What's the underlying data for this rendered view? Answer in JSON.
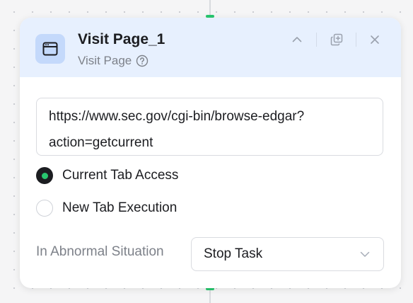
{
  "node": {
    "title": "Visit Page_1",
    "subtitle": "Visit Page",
    "icon": "browser-window-icon"
  },
  "header_actions": [
    {
      "name": "collapse",
      "icon": "chevron-up-icon"
    },
    {
      "name": "duplicate",
      "icon": "copy-icon"
    },
    {
      "name": "close",
      "icon": "close-icon"
    }
  ],
  "url": {
    "value": "https://www.sec.gov/cgi-bin/browse-edgar?action=getcurrent"
  },
  "tab_mode": {
    "options": [
      {
        "label": "Current Tab Access",
        "selected": true
      },
      {
        "label": "New Tab Execution",
        "selected": false
      }
    ]
  },
  "abnormal": {
    "label": "In Abnormal Situation",
    "selected": "Stop Task"
  },
  "colors": {
    "accent_green": "#28c76f",
    "header_bg": "#e7f0fe",
    "icon_bg": "#c4d9fb"
  }
}
